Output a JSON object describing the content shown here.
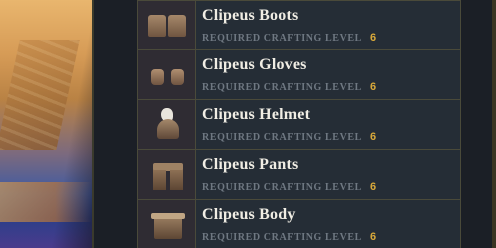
{
  "items": [
    {
      "name": "Clipeus Boots",
      "req_label": "REQUIRED CRAFTING LEVEL",
      "req_level": "6",
      "icon": "boots-icon"
    },
    {
      "name": "Clipeus Gloves",
      "req_label": "REQUIRED CRAFTING LEVEL",
      "req_level": "6",
      "icon": "gloves-icon"
    },
    {
      "name": "Clipeus Helmet",
      "req_label": "REQUIRED CRAFTING LEVEL",
      "req_level": "6",
      "icon": "helmet-icon"
    },
    {
      "name": "Clipeus Pants",
      "req_label": "REQUIRED CRAFTING LEVEL",
      "req_level": "6",
      "icon": "pants-icon"
    },
    {
      "name": "Clipeus Body",
      "req_label": "REQUIRED CRAFTING LEVEL",
      "req_level": "6",
      "icon": "body-armor-icon"
    }
  ],
  "colors": {
    "panel_bg": "#1b1f26",
    "item_bg": "#252d36",
    "item_border": "#4a4a3a",
    "name_text": "#f0ede4",
    "label_text": "#6f7882",
    "level_text": "#d9a93a"
  }
}
